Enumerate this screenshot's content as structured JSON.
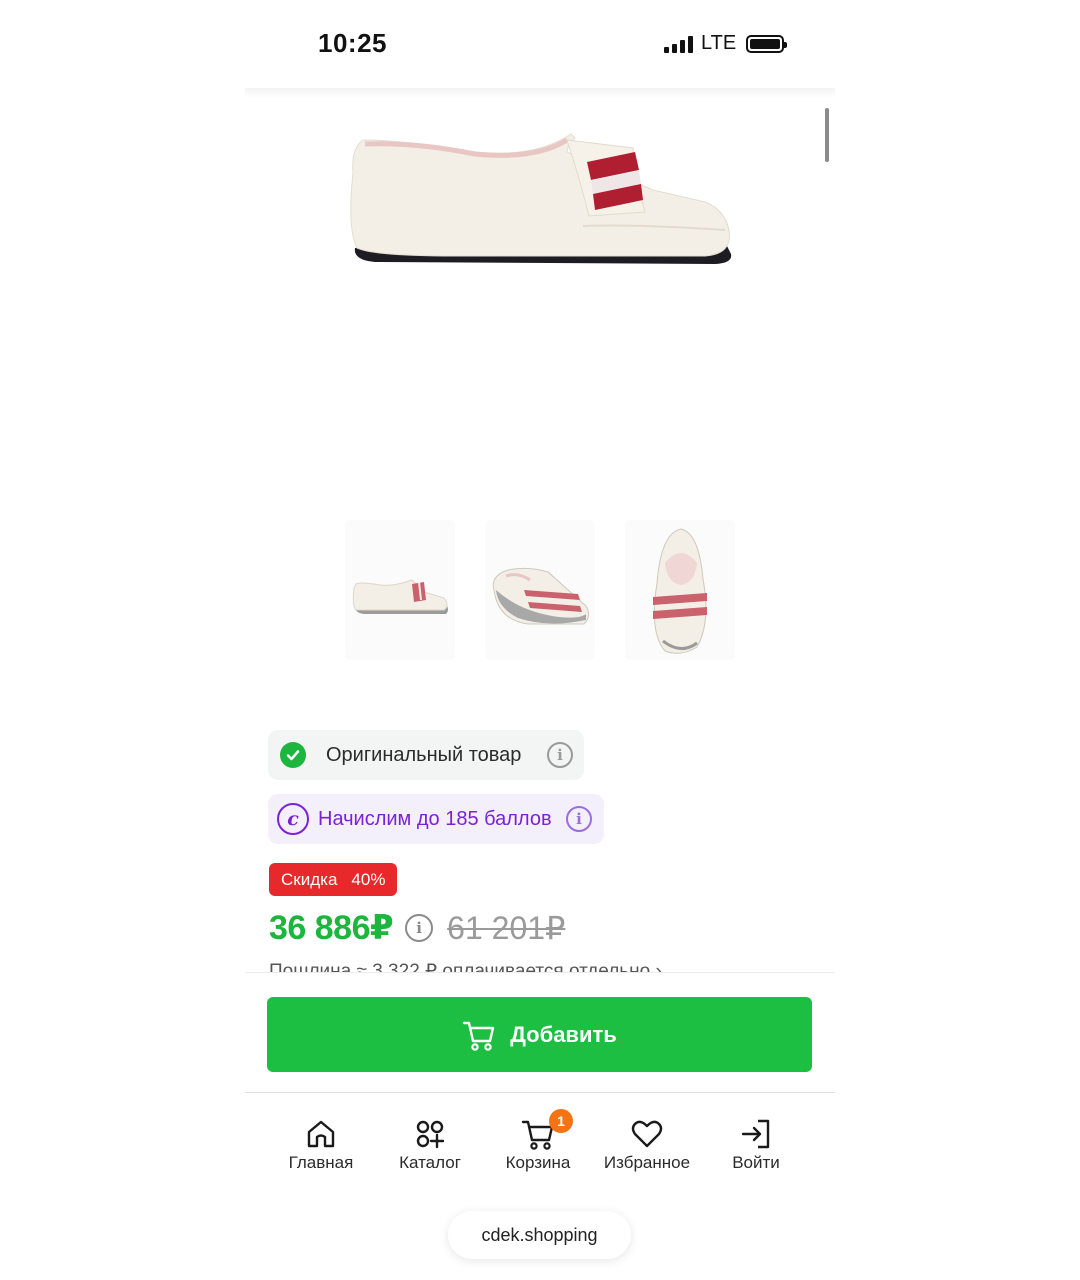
{
  "status_bar": {
    "time": "10:25",
    "network": "LTE",
    "icons": [
      "signal-icon",
      "battery-icon"
    ]
  },
  "product": {
    "gallery": {
      "main_image": "loafer-side-view",
      "thumbnails": [
        "loafer-side-view",
        "loafer-angle-view",
        "loafer-top-view"
      ]
    },
    "original_badge": {
      "label": "Оригинальный товар",
      "icon": "check-circle-icon"
    },
    "points_badge": {
      "label": "Начислим до 185 баллов",
      "icon": "points-c-icon"
    },
    "discount": {
      "label": "Скидка",
      "value": "40%"
    },
    "price": {
      "current": "36 886₽",
      "old": "61 201₽"
    },
    "duty_text": "Пошлина ≈ 3 322 ₽ оплачивается отдельно"
  },
  "add_button": {
    "label": "Добавить",
    "icon": "cart-icon"
  },
  "tabbar": {
    "items": [
      {
        "label": "Главная",
        "icon": "home-icon"
      },
      {
        "label": "Каталог",
        "icon": "catalog-icon"
      },
      {
        "label": "Корзина",
        "icon": "cart-icon",
        "badge": "1"
      },
      {
        "label": "Избранное",
        "icon": "heart-icon"
      },
      {
        "label": "Войти",
        "icon": "login-icon"
      }
    ]
  },
  "browser": {
    "url": "cdek.shopping"
  },
  "colors": {
    "green": "#1cbf41",
    "price_green": "#1cb53d",
    "discount_red": "#e8292b",
    "points_purple": "#7a22d6",
    "cart_badge_orange": "#f47414"
  }
}
